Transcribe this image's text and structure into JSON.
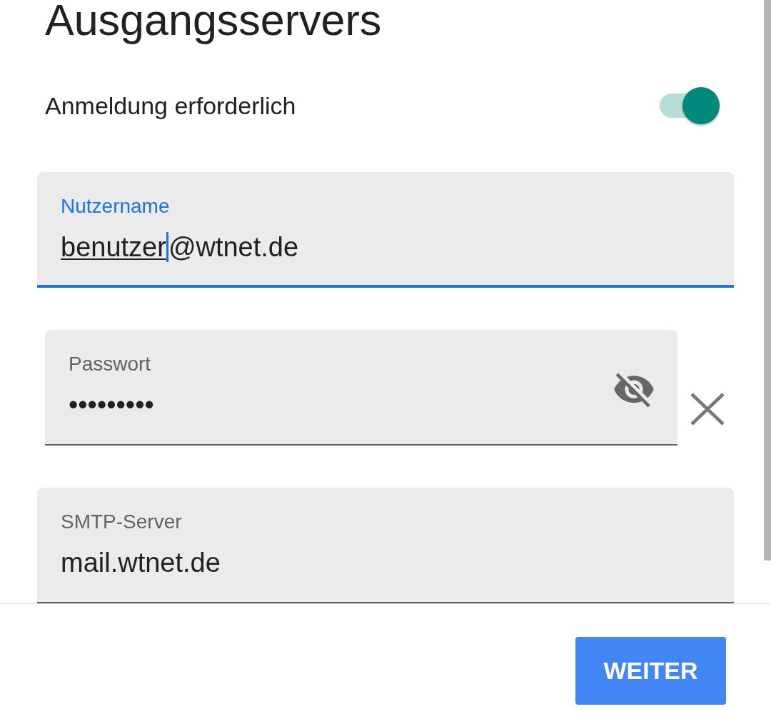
{
  "header": {
    "title": "Ausgangsservers"
  },
  "login_required": {
    "label": "Anmeldung erforderlich",
    "on": true
  },
  "fields": [
    {
      "kind": "text",
      "label": "Nutzername",
      "focused": true,
      "value_segments": [
        {
          "text": "benutzer",
          "composing": true,
          "caret": true
        },
        {
          "text": "@wtnet.de",
          "composing": false,
          "caret": false
        }
      ]
    },
    {
      "kind": "password",
      "label": "Passwort",
      "focused": false,
      "revealed": false,
      "value_segments": [
        {
          "text": "•••••••••",
          "composing": false,
          "caret": false
        }
      ]
    },
    {
      "kind": "text",
      "label": "SMTP-Server",
      "focused": false,
      "value_segments": [
        {
          "text": "mail.wtnet.de",
          "composing": false,
          "caret": false
        }
      ]
    }
  ],
  "footer": {
    "button": "WEITER"
  }
}
